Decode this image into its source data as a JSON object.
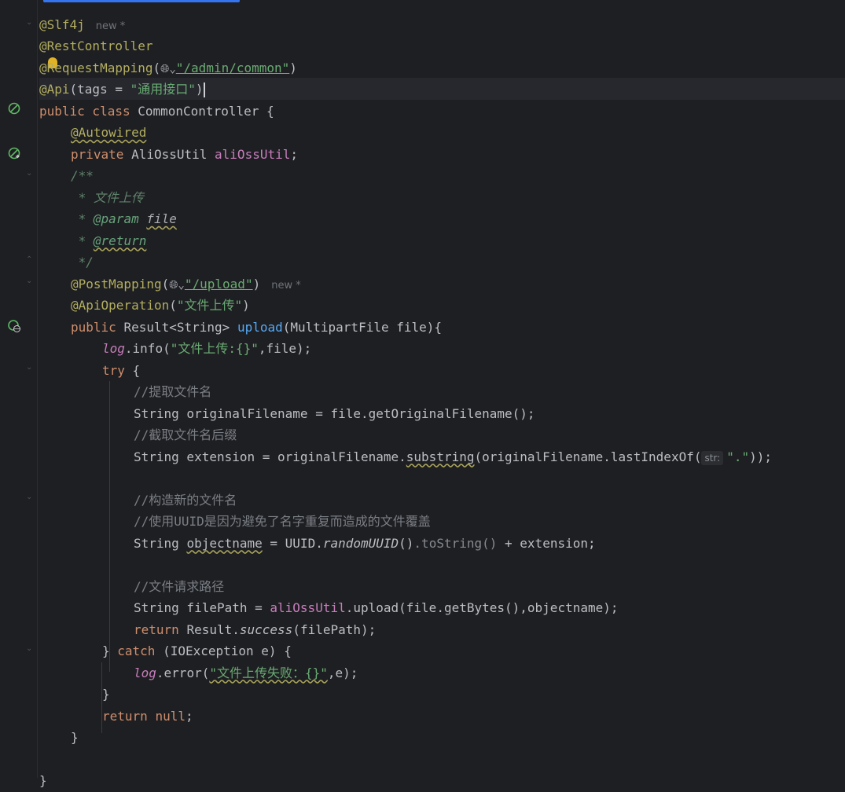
{
  "lines": {
    "l1": {
      "ann": "@Slf4j",
      "hint": "new *"
    },
    "l2": {
      "ann": "@RestController"
    },
    "l3": {
      "ann": "@RequestMapping",
      "open": "(",
      "path": "\"/admin/common\"",
      "close": ")"
    },
    "l4": {
      "ann": "@Api",
      "text": "(tags = ",
      "str": "\"通用接口\"",
      "close": ")"
    },
    "l5": {
      "kw": "public class ",
      "text": "CommonController {"
    },
    "l6": {
      "ann": "@Autowired"
    },
    "l7": {
      "kw": "private ",
      "type": "AliOssUtil ",
      "field": "aliOssUtil",
      "semi": ";"
    },
    "l8": {
      "doc": "/**"
    },
    "l9": {
      "doc": " * 文件上传"
    },
    "l10": {
      "doc": " * ",
      "tag": "@param",
      "param": "file"
    },
    "l11": {
      "doc": " * ",
      "tag": "@return"
    },
    "l12": {
      "doc": " */"
    },
    "l13": {
      "ann": "@PostMapping",
      "open": "(",
      "path": "\"/upload\"",
      "close": ")",
      "hint": "new *"
    },
    "l14": {
      "ann": "@ApiOperation",
      "open": "(",
      "str": "\"文件上传\"",
      "close": ")"
    },
    "l15": {
      "kw": "public ",
      "type": "Result<String> ",
      "fn": "upload",
      "rest": "(MultipartFile file){"
    },
    "l16": {
      "field": "log",
      "text": ".info(",
      "str": "\"文件上传:{}\"",
      "rest": ",file);"
    },
    "l17": {
      "kw": "try ",
      "text": "{"
    },
    "l18": {
      "cmt": "//提取文件名"
    },
    "l19": {
      "text": "String originalFilename = file.getOriginalFilename();"
    },
    "l20": {
      "cmt": "//截取文件名后缀"
    },
    "l21": {
      "text": "String extension = originalFilename.",
      "method": "substring",
      "rest": "(originalFilename.lastIndexOf(",
      "inhint": "str:",
      "str": "\".\"",
      "end": "));"
    },
    "l23": {
      "cmt": "//构造新的文件名"
    },
    "l24": {
      "cmt": "//使用UUID是因为避免了名字重复而造成的文件覆盖"
    },
    "l25": {
      "text": "String ",
      "var": "objectname",
      "mid": " = UUID.",
      "static": "randomUUID",
      "p1": "()",
      "grey": ".toString",
      "p2": "()",
      "rest": " + extension;"
    },
    "l27": {
      "cmt": "//文件请求路径"
    },
    "l28": {
      "text": "String filePath = ",
      "field": "aliOssUtil",
      "rest": ".upload(file.getBytes(),objectname);"
    },
    "l29": {
      "kw": "return ",
      "text": "Result.",
      "static": "success",
      "rest": "(filePath);"
    },
    "l30": {
      "text": "} ",
      "kw": "catch ",
      "rest": "(IOException e) {"
    },
    "l31": {
      "field": "log",
      "text": ".error(",
      "str": "\"文件上传失败：{}\"",
      "rest": ",e);"
    },
    "l32": {
      "text": "}"
    },
    "l33": {
      "kw": "return ",
      "kw2": "null",
      "semi": ";"
    },
    "l34": {
      "text": "}"
    },
    "l36": {
      "text": "}"
    }
  }
}
